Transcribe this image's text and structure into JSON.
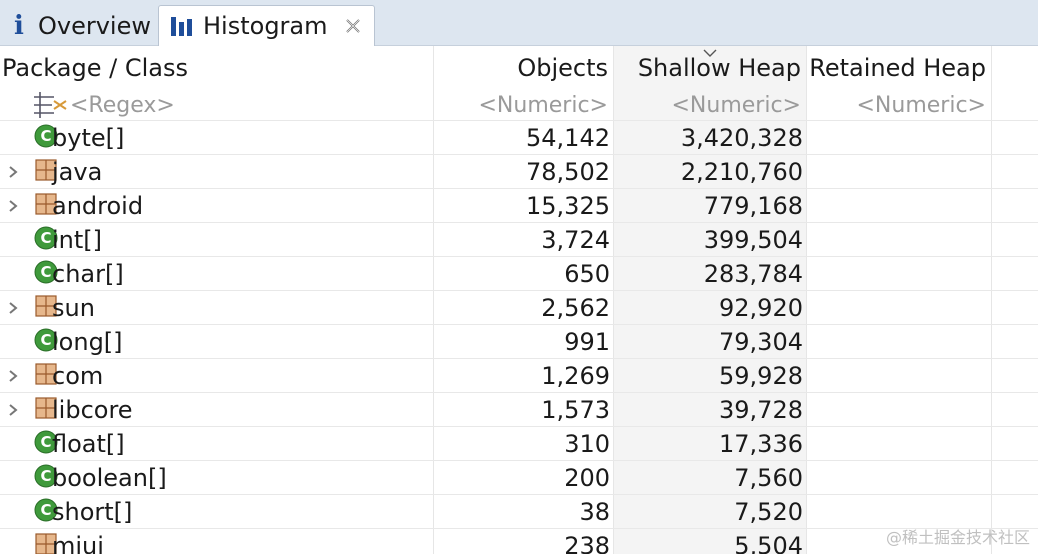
{
  "tabs": [
    {
      "label": "Overview",
      "icon": "info-icon",
      "active": false
    },
    {
      "label": "Histogram",
      "icon": "bar-chart-icon",
      "active": true,
      "closable": true
    }
  ],
  "columns": {
    "package": "Package / Class",
    "objects": "Objects",
    "shallow": "Shallow Heap",
    "retained": "Retained Heap"
  },
  "filters": {
    "package": "<Regex>",
    "objects": "<Numeric>",
    "shallow": "<Numeric>",
    "retained": "<Numeric>"
  },
  "rows": [
    {
      "name": "byte[]",
      "objects": "54,142",
      "shallow": "3,420,328",
      "retained": "",
      "kind": "class",
      "expandable": false
    },
    {
      "name": "java",
      "objects": "78,502",
      "shallow": "2,210,760",
      "retained": "",
      "kind": "package",
      "expandable": true
    },
    {
      "name": "android",
      "objects": "15,325",
      "shallow": "779,168",
      "retained": "",
      "kind": "package",
      "expandable": true
    },
    {
      "name": "int[]",
      "objects": "3,724",
      "shallow": "399,504",
      "retained": "",
      "kind": "class",
      "expandable": false
    },
    {
      "name": "char[]",
      "objects": "650",
      "shallow": "283,784",
      "retained": "",
      "kind": "class",
      "expandable": false
    },
    {
      "name": "sun",
      "objects": "2,562",
      "shallow": "92,920",
      "retained": "",
      "kind": "package",
      "expandable": true
    },
    {
      "name": "long[]",
      "objects": "991",
      "shallow": "79,304",
      "retained": "",
      "kind": "class",
      "expandable": false
    },
    {
      "name": "com",
      "objects": "1,269",
      "shallow": "59,928",
      "retained": "",
      "kind": "package",
      "expandable": true
    },
    {
      "name": "libcore",
      "objects": "1,573",
      "shallow": "39,728",
      "retained": "",
      "kind": "package",
      "expandable": true
    },
    {
      "name": "float[]",
      "objects": "310",
      "shallow": "17,336",
      "retained": "",
      "kind": "class",
      "expandable": false
    },
    {
      "name": "boolean[]",
      "objects": "200",
      "shallow": "7,560",
      "retained": "",
      "kind": "class",
      "expandable": false
    },
    {
      "name": "short[]",
      "objects": "38",
      "shallow": "7,520",
      "retained": "",
      "kind": "class",
      "expandable": false
    },
    {
      "name": "miui",
      "objects": "238",
      "shallow": "5,504",
      "retained": "",
      "kind": "package",
      "expandable": false
    }
  ],
  "watermark": "@稀土掘金技术社区",
  "colors": {
    "tab_bar": "#dde6f0",
    "sorted_column_bg": "#f4f4f4",
    "class_icon": "#3f9a3b",
    "package_icon": "#d9a070",
    "accent": "#1f4e9a"
  }
}
